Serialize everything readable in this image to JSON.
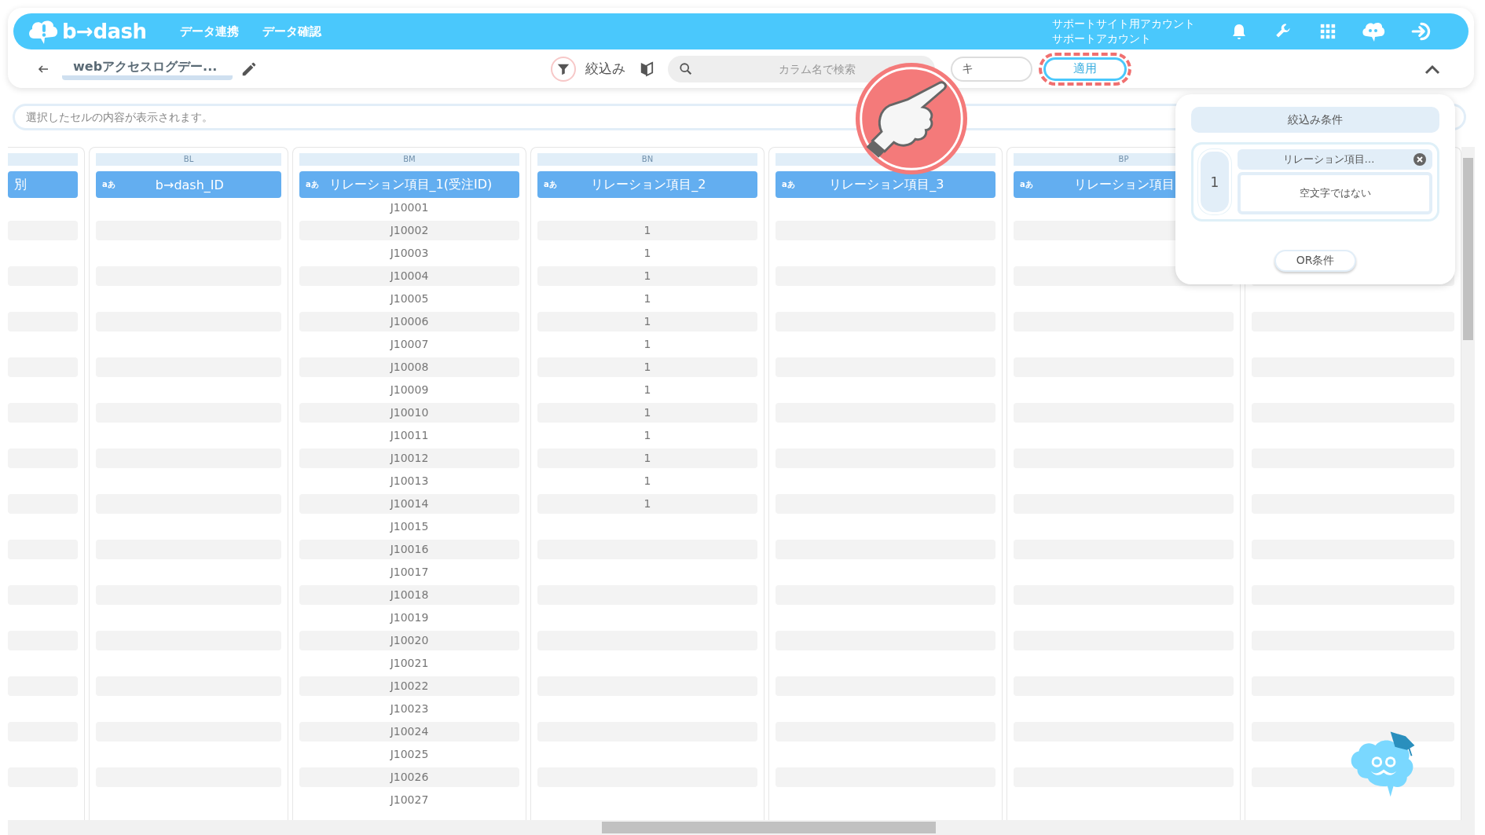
{
  "header": {
    "logo": "b→dash",
    "nav": [
      {
        "label": "データ連携"
      },
      {
        "label": "データ確認"
      }
    ],
    "account": [
      "サポートサイト用アカウント",
      "サポートアカウント"
    ]
  },
  "toolbar": {
    "title": "webアクセスログデー...",
    "filter_label": "絞込み",
    "search": {
      "placeholder": "カラム名で検索"
    },
    "cancel_button": "キ",
    "apply_button": "適用"
  },
  "cell_viewer": {
    "placeholder": "選択したセルの内容が表示されます。"
  },
  "table": {
    "columns": [
      {
        "title": "別"
      },
      {
        "letter": "BL",
        "type_icon": "aあ",
        "title": "b→dash_ID"
      },
      {
        "letter": "BM",
        "type_icon": "aあ",
        "title": "リレーション項目_1(受注ID)"
      },
      {
        "letter": "BN",
        "type_icon": "aあ",
        "title": "リレーション項目_2"
      },
      {
        "type_icon": "aあ",
        "title": "リレーション項目_3"
      },
      {
        "letter": "BP",
        "type_icon": "aあ",
        "title": "リレーション項目"
      }
    ],
    "rows": [
      {
        "BM": "J10001"
      },
      {
        "BM": "J10002",
        "BN": "1"
      },
      {
        "BM": "J10003",
        "BN": "1"
      },
      {
        "BM": "J10004",
        "BN": "1"
      },
      {
        "BM": "J10005",
        "BN": "1"
      },
      {
        "BM": "J10006",
        "BN": "1"
      },
      {
        "BM": "J10007",
        "BN": "1"
      },
      {
        "BM": "J10008",
        "BN": "1"
      },
      {
        "BM": "J10009",
        "BN": "1"
      },
      {
        "BM": "J10010",
        "BN": "1"
      },
      {
        "BM": "J10011",
        "BN": "1"
      },
      {
        "BM": "J10012",
        "BN": "1"
      },
      {
        "BM": "J10013",
        "BN": "1"
      },
      {
        "BM": "J10014",
        "BN": "1"
      },
      {
        "BM": "J10015"
      },
      {
        "BM": "J10016"
      },
      {
        "BM": "J10017"
      },
      {
        "BM": "J10018"
      },
      {
        "BM": "J10019"
      },
      {
        "BM": "J10020"
      },
      {
        "BM": "J10021"
      },
      {
        "BM": "J10022"
      },
      {
        "BM": "J10023"
      },
      {
        "BM": "J10024"
      },
      {
        "BM": "J10025"
      },
      {
        "BM": "J10026"
      },
      {
        "BM": "J10027"
      }
    ]
  },
  "filter_panel": {
    "title": "絞込み条件",
    "conditions": [
      {
        "number": "1",
        "field": "リレーション項目…",
        "value": "空文字ではない"
      }
    ],
    "or_button": "OR条件"
  }
}
